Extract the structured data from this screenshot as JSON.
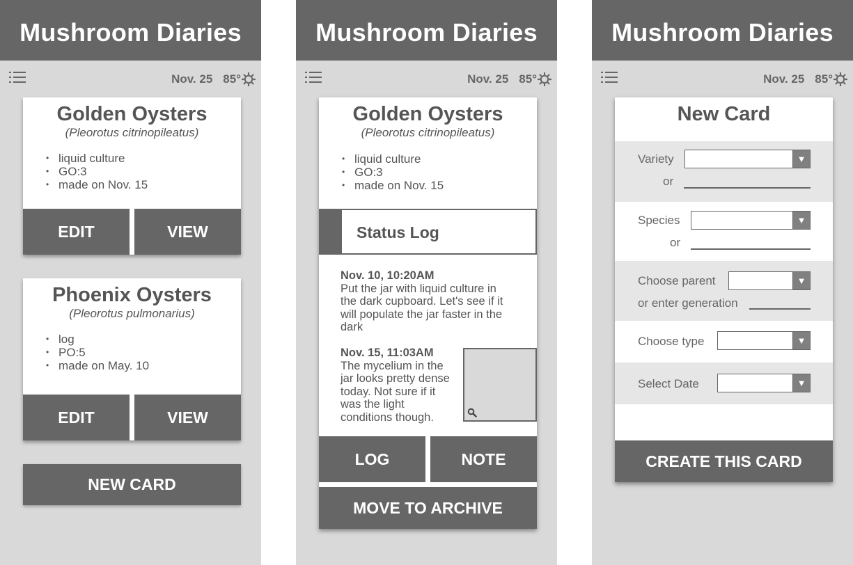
{
  "app": {
    "title": "Mushroom Diaries"
  },
  "status": {
    "date": "Nov. 25",
    "temp": "85°"
  },
  "screen1": {
    "cards": [
      {
        "name": "Golden Oysters",
        "latin": "(Pleorotus citrinopileatus)",
        "items": [
          "liquid culture",
          "GO:3",
          "made on Nov. 15"
        ],
        "edit": "EDIT",
        "view": "VIEW"
      },
      {
        "name": "Phoenix Oysters",
        "latin": "(Pleorotus pulmonarius)",
        "items": [
          "log",
          "PO:5",
          "made on May. 10"
        ],
        "edit": "EDIT",
        "view": "VIEW"
      }
    ],
    "new_card": "NEW CARD"
  },
  "screen2": {
    "card": {
      "name": "Golden Oysters",
      "latin": "(Pleorotus citrinopileatus)",
      "items": [
        "liquid culture",
        "GO:3",
        "made on Nov. 15"
      ]
    },
    "status_log_title": "Status Log",
    "entries": [
      {
        "when": "Nov. 10, 10:20AM",
        "lines": [
          "Put the jar with liquid culture in",
          "the dark cupboard. Let's see if it",
          "will populate the jar faster in the",
          "dark"
        ]
      },
      {
        "when": "Nov. 15, 11:03AM",
        "lines": [
          "The mycelium in the",
          "jar looks pretty dense",
          "today. Not sure if it",
          "was the light",
          "conditions though."
        ]
      }
    ],
    "log": "LOG",
    "note": "NOTE",
    "archive": "MOVE TO ARCHIVE"
  },
  "screen3": {
    "title": "New Card",
    "variety": "Variety",
    "or": "or",
    "species": "Species",
    "parent": "Choose parent",
    "generation": "or enter generation",
    "type": "Choose type",
    "date": "Select Date",
    "create": "CREATE THIS CARD"
  },
  "icons": {
    "menu": "menu-list-icon",
    "sun": "sun-icon",
    "dropdown": "dropdown-arrow-icon",
    "zoom": "magnifier-icon"
  },
  "colors": {
    "header": "#666666",
    "background": "#d9d9d9",
    "button": "#666666",
    "card": "#ffffff",
    "band": "#e6e6e6"
  }
}
